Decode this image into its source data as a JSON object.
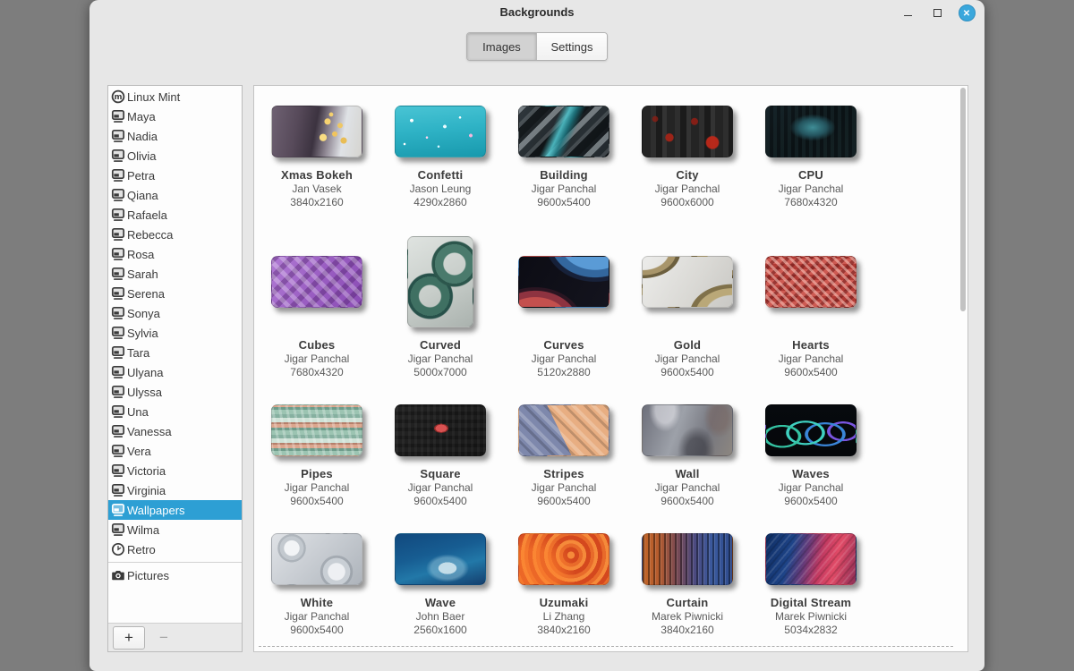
{
  "window": {
    "title": "Backgrounds",
    "minimize_glyph": "–",
    "close_glyph": "✕"
  },
  "tabs": [
    {
      "label": "Images",
      "active": true
    },
    {
      "label": "Settings",
      "active": false
    }
  ],
  "sidebar": {
    "items": [
      {
        "label": "Linux Mint",
        "icon": "linuxmint-logo-icon"
      },
      {
        "label": "Maya",
        "icon": "display-icon"
      },
      {
        "label": "Nadia",
        "icon": "display-icon"
      },
      {
        "label": "Olivia",
        "icon": "display-icon"
      },
      {
        "label": "Petra",
        "icon": "display-icon"
      },
      {
        "label": "Qiana",
        "icon": "display-icon"
      },
      {
        "label": "Rafaela",
        "icon": "display-icon"
      },
      {
        "label": "Rebecca",
        "icon": "display-icon"
      },
      {
        "label": "Rosa",
        "icon": "display-icon"
      },
      {
        "label": "Sarah",
        "icon": "display-icon"
      },
      {
        "label": "Serena",
        "icon": "display-icon"
      },
      {
        "label": "Sonya",
        "icon": "display-icon"
      },
      {
        "label": "Sylvia",
        "icon": "display-icon"
      },
      {
        "label": "Tara",
        "icon": "display-icon"
      },
      {
        "label": "Ulyana",
        "icon": "display-icon"
      },
      {
        "label": "Ulyssa",
        "icon": "display-icon"
      },
      {
        "label": "Una",
        "icon": "display-icon"
      },
      {
        "label": "Vanessa",
        "icon": "display-icon"
      },
      {
        "label": "Vera",
        "icon": "display-icon"
      },
      {
        "label": "Victoria",
        "icon": "display-icon"
      },
      {
        "label": "Virginia",
        "icon": "display-icon"
      },
      {
        "label": "Wallpapers",
        "icon": "display-icon",
        "selected": true
      },
      {
        "label": "Wilma",
        "icon": "display-icon"
      },
      {
        "label": "Retro",
        "icon": "clock-icon"
      },
      {
        "label": "Pictures",
        "icon": "camera-icon",
        "separator_before": true
      }
    ],
    "add_label": "+",
    "remove_label": "−"
  },
  "wallpapers": [
    {
      "name": "Xmas Bokeh",
      "author": "Jan Vasek",
      "resolution": "3840x2160",
      "bg": "radial-gradient(circle 6px at 62% 30%, #f6d270 55%, transparent 62%), radial-gradient(circle 5px at 70% 55%, #f0c45e 55%, transparent 62%), radial-gradient(circle 7px at 57% 62%, #f8dc82 55%, transparent 62%), radial-gradient(circle 5px at 76% 38%, #eec765 55%, transparent 62%), radial-gradient(circle 4px at 66% 16%, #f4d06e 55%, transparent 62%), radial-gradient(circle 6px at 80% 68%, #e9bd55 55%, transparent 62%), linear-gradient(100deg, #6e6172 0%, #574a5a 28%, #3c3340 48%, #8c8490 62%, #dfe2e6 78%, #d5d4cf 100%)"
    },
    {
      "name": "Confetti",
      "author": "Jason Leung",
      "resolution": "4290x2860",
      "bg": "radial-gradient(circle 3px at 18% 28%, #ffffff 60%, transparent 70%), radial-gradient(circle 2px at 35% 62%, #ffd3ee 60%, transparent 70%), radial-gradient(circle 3px at 55% 40%, #e8fbff 60%, transparent 70%), radial-gradient(circle 2px at 72% 22%, #ffffff 60%, transparent 70%), radial-gradient(circle 3px at 84% 58%, #f7b7de 60%, transparent 70%), radial-gradient(circle 2px at 48% 80%, #d6f6ff 60%, transparent 70%), radial-gradient(circle 2px at 10% 75%, #ffffff 60%, transparent 70%), linear-gradient(175deg, #49c4d4 0%, #2fb3c6 45%, #1899ad 100%)"
    },
    {
      "name": "Building",
      "author": "Jigar Panchal",
      "resolution": "9600x5400",
      "bg": "linear-gradient(115deg, rgba(80,200,210,0) 38%, rgba(84,205,214,.85) 46%, rgba(30,120,130,.9) 52%, rgba(80,200,210,0) 60%), repeating-linear-gradient(135deg, rgba(190,200,205,.55) 0 6px, rgba(60,70,76,.4) 6px 13px, rgba(150,160,165,.35) 13px 17px, rgba(10,14,16,.5) 17px 26px, transparent 26px 30px), linear-gradient(120deg, #262c31 0%, #14181b 45%, #1b2125 70%, #101418 100%)"
    },
    {
      "name": "City",
      "author": "Jigar Panchal",
      "resolution": "9600x6000",
      "bg": "radial-gradient(circle 11px at 78% 72%, rgba(190,40,25,.95) 60%, transparent 72%), radial-gradient(circle 7px at 30% 62%, rgba(170,35,22,.9) 60%, transparent 72%), radial-gradient(circle 6px at 58% 30%, rgba(150,30,20,.85) 60%, transparent 72%), radial-gradient(circle 5px at 14% 25%, rgba(140,30,20,.8) 60%, transparent 72%), repeating-linear-gradient(90deg, #242424 0 9px, #2e2e2e 9px 15px, #1b1b1b 15px 22px, #333333 22px 27px), linear-gradient(180deg, #2a2a2a, #1d1d1d)"
    },
    {
      "name": "CPU",
      "author": "Jigar Panchal",
      "resolution": "7680x4320",
      "bg": "radial-gradient(ellipse 34px 20px at 52% 42%, #3f8d96 0%, #24545e 45%, transparent 75%), repeating-linear-gradient(90deg, rgba(70,120,126,.12) 0 4px, transparent 4px 8px), linear-gradient(135deg, #10181c 0%, #0a1114 50%, #0d1518 100%)"
    },
    {
      "name": "Cubes",
      "author": "Jigar Panchal",
      "resolution": "7680x4320",
      "bg": "repeating-linear-gradient(45deg, rgba(255,255,255,.28) 0 5px, transparent 5px 11px), repeating-linear-gradient(-45deg, rgba(70,25,95,.35) 0 6px, transparent 6px 13px), linear-gradient(120deg, #b07ad4 0%, #9a5ec2 50%, #8a4cb4 100%)"
    },
    {
      "name": "Curved",
      "author": "Jigar Panchal",
      "resolution": "5000x7000",
      "portrait": true,
      "bg": "radial-gradient(circle 26px at 72% 30%, rgba(0,0,0,0) 12px, #4a7a6c 13px 22px, #2c564c 22px 25px, rgba(0,0,0,0) 26px), radial-gradient(circle 26px at 34% 66%, rgba(0,0,0,0) 12px, #3f7062 13px 22px, #27514a 22px 25px, rgba(0,0,0,0) 26px), linear-gradient(150deg, #dfe3e0 0%, #c7cdc9 55%, #aab2ae 100%)"
    },
    {
      "name": "Curves",
      "author": "Jigar Panchal",
      "resolution": "5120x2880",
      "bg": "radial-gradient(ellipse 70px 55px at 18% 135%, #c4504e 0 55%, #8e3340 56% 68%, rgba(60,25,40,.6) 69% 75%, transparent 76%), radial-gradient(ellipse 75px 60px at 85% -30%, #5a9bd6 0 52%, #33679e 53% 66%, rgba(30,50,90,.5) 67% 74%, transparent 75%), linear-gradient(120deg, #0c0c14 0%, #14141e 100%)"
    },
    {
      "name": "Gold",
      "author": "Jigar Panchal",
      "resolution": "9600x5400",
      "bg": "radial-gradient(ellipse 60px 42px at 0% -10%, transparent 48%, #a8956a 50% 62%, #6c5f3e 63% 70%, transparent 71%), radial-gradient(ellipse 70px 50px at 100% 115%, transparent 42%, #baa878 44% 58%, #80714a 59% 67%, transparent 68%), linear-gradient(120deg, #ececea 0%, #d9d8d4 60%, #c9c8c4 100%)"
    },
    {
      "name": "Hearts",
      "author": "Jigar Panchal",
      "resolution": "9600x5400",
      "bg": "repeating-linear-gradient(45deg, rgba(255,210,200,.5) 0 3px, transparent 3px 7px), repeating-linear-gradient(-45deg, rgba(90,15,15,.45) 0 4px, transparent 4px 9px), repeating-linear-gradient(0deg, #cd5a52 0 6px, #b03a34 6px 12px)"
    },
    {
      "name": "Pipes",
      "author": "Jigar Panchal",
      "resolution": "9600x5400",
      "bg": "repeating-linear-gradient(80deg, rgba(255,255,255,.25) 0 3px, transparent 3px 8px), repeating-linear-gradient(0deg, #9cc4b2 0 5px, #6d9b89 5px 8px, #dba68e 8px 12px, #b57f6b 12px 14px, #cfe2d7 14px 19px, #86b0a0 19px 23px)"
    },
    {
      "name": "Square",
      "author": "Jigar Panchal",
      "resolution": "9600x5400",
      "bg": "radial-gradient(ellipse 11px 7px at 51% 46%, #d95252 0 58%, #8e2a28 59% 72%, transparent 73%), repeating-linear-gradient(90deg, rgba(255,255,255,.04) 0 3px, transparent 3px 7px), repeating-linear-gradient(0deg, rgba(0,0,0,.25) 0 4px, transparent 4px 9px), linear-gradient(120deg, #232323, #1a1a1a)"
    },
    {
      "name": "Stripes",
      "author": "Jigar Panchal",
      "resolution": "9600x5400",
      "bg": "repeating-linear-gradient(45deg, rgba(255,255,255,.22) 0 4px, transparent 4px 10px, rgba(0,0,0,.18) 10px 13px, transparent 13px 16px), linear-gradient(64deg, #7e88ac 0 46%, #e8ae82 46% 100%)"
    },
    {
      "name": "Wall",
      "author": "Jigar Panchal",
      "resolution": "9600x5400",
      "bg": "radial-gradient(ellipse 30px 40px at 25% 10%, rgba(240,240,245,.55) 0 35%, transparent 60%), radial-gradient(ellipse 35px 45px at 60% 90%, rgba(40,40,48,.5) 0 30%, transparent 60%), radial-gradient(ellipse 28px 38px at 85% 25%, rgba(120,100,95,.5) 0 35%, transparent 60%), linear-gradient(110deg, #6d6f7a 0%, #9da1a9 40%, #75767e 70%, #8d8781 100%)"
    },
    {
      "name": "Waves",
      "author": "Jigar Panchal",
      "resolution": "9600x5400",
      "bg": "radial-gradient(ellipse 30px 18px at 18% 62%, transparent 58%, #34c2a2 60% 70%, transparent 72%), radial-gradient(ellipse 32px 20px at 44% 55%, transparent 56%, #3fd0c0 58% 67%, transparent 69%), radial-gradient(ellipse 34px 20px at 66% 58%, transparent 55%, #3a86d8 57% 66%, transparent 68%), radial-gradient(ellipse 26px 16px at 86% 52%, transparent 54%, #7a55e0 56% 68%, transparent 70%), linear-gradient(180deg, #070a0e 0%, #05070a 100%)"
    },
    {
      "name": "White",
      "author": "Jigar Panchal",
      "resolution": "9600x5400",
      "bg": "radial-gradient(circle 30px at 22% 28%, #f2f4f6 0 28%, #c3c9cf 30% 44%, rgba(150,158,166,.6) 45% 52%, transparent 53%), radial-gradient(circle 36px at 72% 75%, #eef0f3 0 26%, #c9cfd5 28% 42%, rgba(140,148,156,.55) 43% 50%, transparent 51%), linear-gradient(135deg, #dfe2e6 0%, #c2c7cd 60%, #aeb4bb 100%)"
    },
    {
      "name": "Wave",
      "author": "John Baer",
      "resolution": "2560x1600",
      "bg": "radial-gradient(ellipse 40px 26px at 58% 68%, rgba(225,240,245,.85) 0 25%, rgba(160,205,225,.45) 26% 45%, transparent 60%), linear-gradient(165deg, #11497e 0%, #175d92 40%, #2278a8 65%, #153f6e 100%)"
    },
    {
      "name": "Uzumaki",
      "author": "Li Zhang",
      "resolution": "3840x2160",
      "bg": "radial-gradient(circle at 15% 80%, rgba(255,130,45,.55) 0 28%, transparent 50%), repeating-radial-gradient(circle at 58% 42%, #f58a3a 0 4px, #d4481e 4px 9px, #e86a2a 9px 13px)"
    },
    {
      "name": "Curtain",
      "author": "Marek Piwnicki",
      "resolution": "3840x2160",
      "bg": "repeating-linear-gradient(90deg, rgba(0,0,0,.4) 0 2px, rgba(255,255,255,.12) 2px 3px, transparent 3px 6px), linear-gradient(90deg, #c06428 0%, #b65c2e 18%, #7a4a52 38%, #4c4a80 58%, #3a5a9e 78%, #2e4a8c 100%)"
    },
    {
      "name": "Digital Stream",
      "author": "Marek Piwnicki",
      "resolution": "5034x2832",
      "bg": "repeating-linear-gradient(130deg, rgba(255,255,255,.12) 0 2px, transparent 2px 5px, rgba(0,0,0,.15) 5px 7px, transparent 7px 10px), linear-gradient(105deg, #0e2d62 0%, #1e4488 28%, #6a3a78 45%, #c23a62 60%, #e14a66 75%, #8e2f56 100%)"
    }
  ],
  "colors": {
    "selection_blue": "#2d9fd4",
    "close_button_blue": "#3aa7dc",
    "desktop_grey": "#7d7d7d",
    "window_bg": "#e7e7e7",
    "panel_bg": "#fdfdfd"
  }
}
